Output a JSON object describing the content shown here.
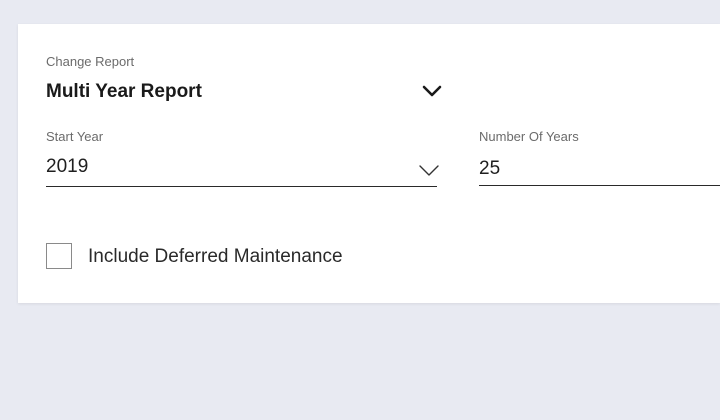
{
  "report": {
    "label": "Change Report",
    "value": "Multi Year Report",
    "icon": "chevron-down-icon"
  },
  "start_year": {
    "label": "Start Year",
    "value": "2019",
    "icon": "chevron-down-icon"
  },
  "number_of_years": {
    "label": "Number Of Years",
    "value": "25"
  },
  "deferred_maintenance": {
    "label": "Include Deferred Maintenance",
    "checked": false
  },
  "colors": {
    "background": "#e8eaf2",
    "panel": "#ffffff",
    "text": "#1f1f1f",
    "muted_label": "#6b6b6b"
  }
}
